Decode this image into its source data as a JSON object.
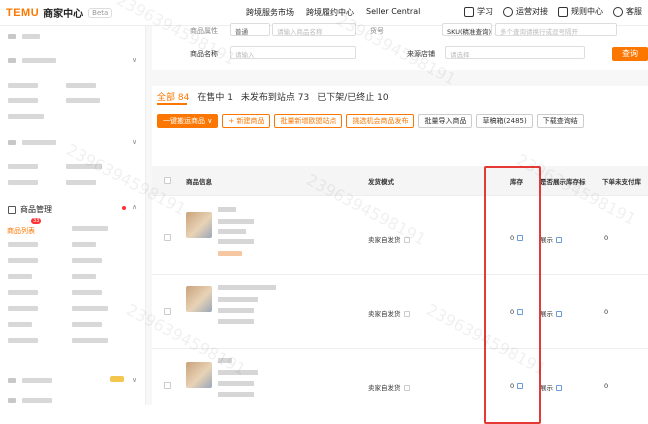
{
  "header": {
    "logo": "TEMU",
    "title": "商家中心",
    "beta": "Beta",
    "nav": [
      "跨境服务市场",
      "跨境履约中心",
      "Seller Central"
    ],
    "right": [
      "学习",
      "运营对接",
      "规则中心",
      "客服"
    ]
  },
  "sidebar": {
    "section_label": "商品管理",
    "badge": "33",
    "active_item": "商品列表"
  },
  "filter": {
    "label_row1_a": "商品属性",
    "value_row1_a": "普通",
    "ph_row1_b": "请输入商品名称",
    "label_row1_c": "货号",
    "value_row1_c": "SKU(精准查询)",
    "ph_row1_d": "多个查询请换行或逗号隔开",
    "name_label": "商品名称",
    "name_placeholder": "请输入",
    "store_label": "来源店铺",
    "store_placeholder": "请选择",
    "query_button": "查询"
  },
  "tabs": [
    {
      "label": "全部 84"
    },
    {
      "label": "在售中 1"
    },
    {
      "label": "未发布到站点 73"
    },
    {
      "label": "已下架/已终止 10"
    }
  ],
  "actions": {
    "one_click": "一键搬运商品 ∨",
    "new": "+ 新建商品",
    "batch_new_site": "批量新增欧盟站点",
    "pick_opportunity": "挑选机会商品发布",
    "batch_import": "批量导入商品",
    "drafts": "草稿箱(2485)",
    "download": "下载查询结"
  },
  "table": {
    "headers": {
      "info": "商品信息",
      "ship_mode": "发货模式",
      "stock": "库存",
      "show_stock": "是否展示库存标",
      "unpaid": "下单未支付库"
    },
    "rows": [
      {
        "ship_mode": "卖家自发货",
        "stock": "0",
        "show": "展示",
        "unpaid": "0"
      },
      {
        "ship_mode": "卖家自发货",
        "stock": "0",
        "show": "展示",
        "unpaid": "0"
      },
      {
        "ship_mode": "卖家自发货",
        "stock": "0",
        "show": "展示",
        "unpaid": "0"
      }
    ]
  },
  "watermark": "2396394598191"
}
